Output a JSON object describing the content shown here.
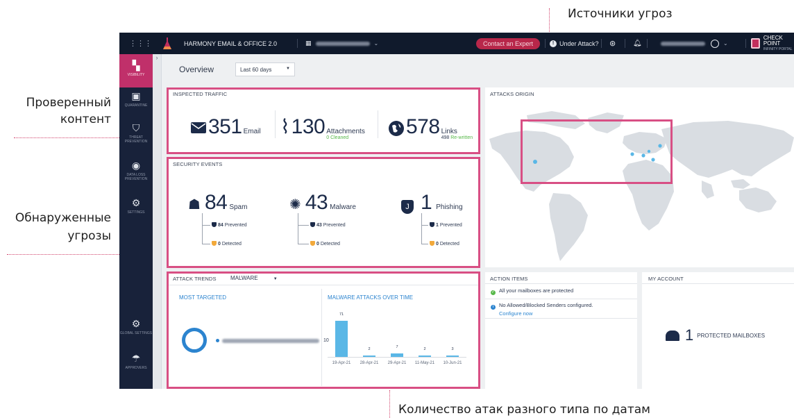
{
  "annotations": {
    "threat_sources": "Источники угроз",
    "checked_content_l1": "Проверенный",
    "checked_content_l2": "контент",
    "detected_threats_l1": "Обнаруженные",
    "detected_threats_l2": "угрозы",
    "attacks_by_date": "Количество атак разного типа по датам"
  },
  "topbar": {
    "app_title": "HARMONY EMAIL & OFFICE 2.0",
    "contact_label": "Contact an Expert",
    "under_attack_label": "Under Attack?",
    "brand_line1": "CHECK POINT",
    "brand_line2": "INFINITY PORTAL"
  },
  "sidebar": {
    "items": [
      {
        "label": "VISIBILITY",
        "icon": "dashboard-icon"
      },
      {
        "label": "QUARANTINE",
        "icon": "quarantine-icon"
      },
      {
        "label": "THREAT PREVENTION",
        "icon": "shield-icon"
      },
      {
        "label": "DATA LOSS PREVENTION",
        "icon": "dlp-icon"
      },
      {
        "label": "SETTINGS",
        "icon": "gear-icon"
      },
      {
        "label": "GLOBAL SETTINGS",
        "icon": "gear-icon"
      },
      {
        "label": "APPROVERS",
        "icon": "approvers-icon"
      }
    ]
  },
  "overview": {
    "title": "Overview",
    "range": "Last 60 days"
  },
  "inspected_traffic": {
    "title": "INSPECTED TRAFFIC",
    "email_count": "351",
    "email_label": "Email",
    "attach_count": "130",
    "attach_label": "Attachments",
    "attach_sub": "0 Cleaned",
    "links_count": "578",
    "links_label": "Links",
    "links_sub_num": "498",
    "links_sub": "Re-written"
  },
  "security_events": {
    "title": "SECURITY EVENTS",
    "items": [
      {
        "count": "84",
        "label": "Spam",
        "prevented_num": "84",
        "prevented": "Prevented",
        "detected_num": "0",
        "detected": "Detected"
      },
      {
        "count": "43",
        "label": "Malware",
        "prevented_num": "43",
        "prevented": "Prevented",
        "detected_num": "0",
        "detected": "Detected"
      },
      {
        "count": "1",
        "label": "Phishing",
        "prevented_num": "1",
        "prevented": "Prevented",
        "detected_num": "0",
        "detected": "Detected"
      }
    ]
  },
  "attacks_origin": {
    "title": "ATTACKS ORIGIN"
  },
  "attack_trends": {
    "title": "ATTACK TRENDS",
    "filter": "MALWARE",
    "most_targeted": "MOST TARGETED",
    "target_count": "10",
    "chart_title": "MALWARE ATTACKS OVER TIME"
  },
  "chart_data": {
    "type": "bar",
    "title": "MALWARE ATTACKS OVER TIME",
    "categories": [
      "19-Apr-21",
      "28-Apr-21",
      "29-Apr-21",
      "11-May-21",
      "10-Jun-21"
    ],
    "values": [
      71,
      2,
      7,
      2,
      3
    ],
    "ylim": [
      0,
      71
    ],
    "grid": false,
    "color": "#5ab7e6"
  },
  "action_items": {
    "title": "ACTION ITEMS",
    "row1": "All your mailboxes are protected",
    "row2": "No Allowed/Blocked Senders configured.",
    "row2_link": "Configure now"
  },
  "my_account": {
    "title": "MY ACCOUNT",
    "count": "1",
    "label": "PROTECTED MAILBOXES"
  },
  "colors": {
    "accent": "#d84f84",
    "navy": "#101a2c",
    "chart": "#5ab7e6"
  }
}
